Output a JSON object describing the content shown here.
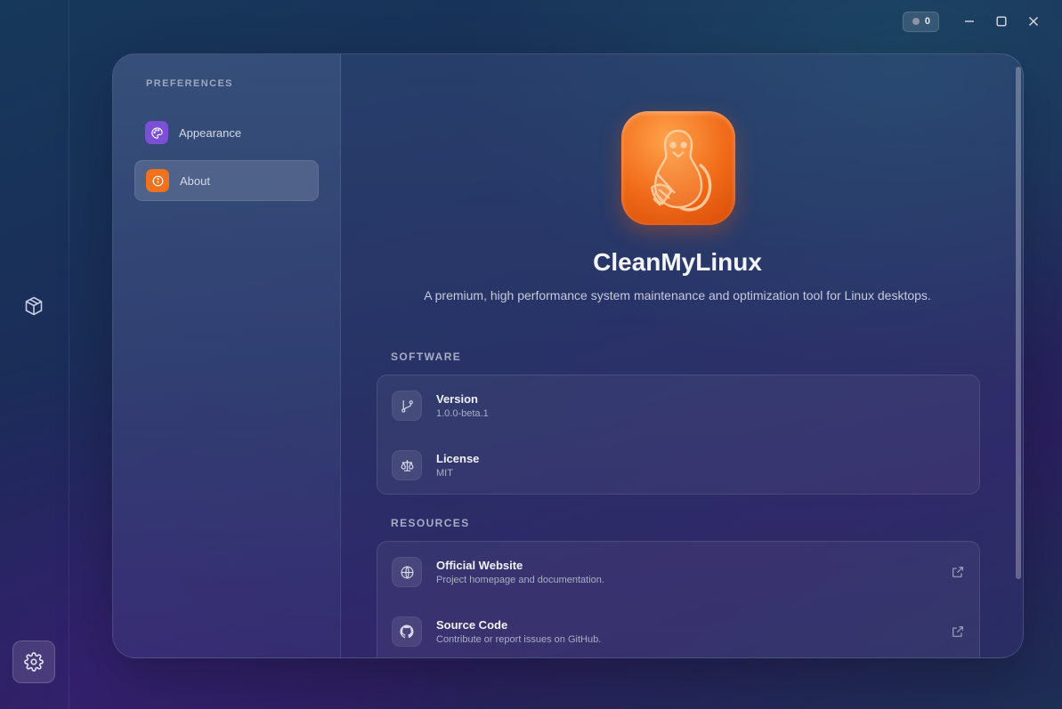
{
  "titlebar": {
    "badge_count": "0"
  },
  "sidebar": {
    "heading": "PREFERENCES",
    "items": [
      {
        "label": "Appearance",
        "icon": "palette-icon",
        "color": "#7b4fd6"
      },
      {
        "label": "About",
        "icon": "info-icon",
        "color": "#f0711e",
        "active": true
      }
    ]
  },
  "about": {
    "app_name": "CleanMyLinux",
    "description": "A premium, high performance system maintenance and optimization tool for Linux desktops.",
    "software": {
      "label": "SOFTWARE",
      "items": [
        {
          "title": "Version",
          "value": "1.0.0-beta.1",
          "icon": "git-branch-icon"
        },
        {
          "title": "License",
          "value": "MIT",
          "icon": "scale-icon"
        }
      ]
    },
    "resources": {
      "label": "RESOURCES",
      "items": [
        {
          "title": "Official Website",
          "value": "Project homepage and documentation.",
          "icon": "globe-icon"
        },
        {
          "title": "Source Code",
          "value": "Contribute or report issues on GitHub.",
          "icon": "github-icon"
        }
      ]
    }
  },
  "colors": {
    "accent_orange": "#f0711e",
    "accent_purple": "#7b4fd6"
  }
}
